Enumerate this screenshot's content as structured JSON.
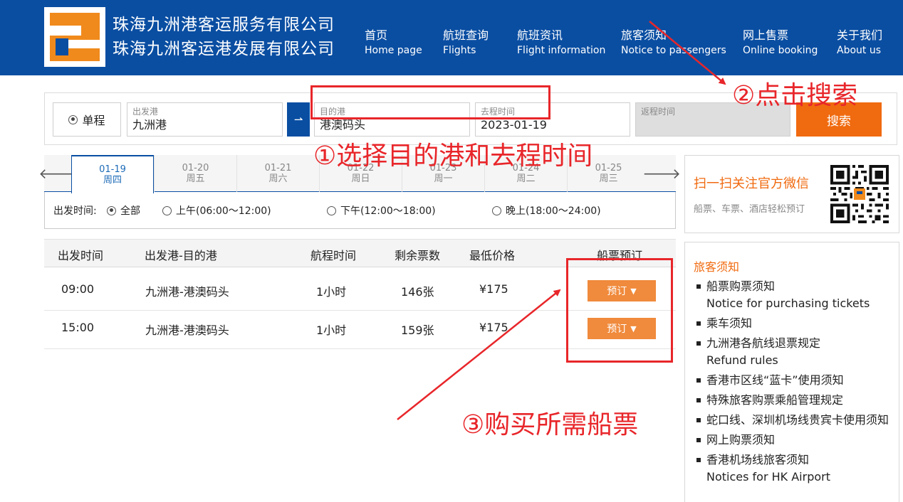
{
  "header": {
    "company_line1": "珠海九洲港客运服务有限公司",
    "company_line2": "珠海九洲客运港发展有限公司",
    "nav": [
      {
        "cn": "首页",
        "en": "Home page"
      },
      {
        "cn": "航班查询",
        "en": "Flights"
      },
      {
        "cn": "航班资讯",
        "en": "Flight information"
      },
      {
        "cn": "旅客须知",
        "en": "Notice to passengers"
      },
      {
        "cn": "网上售票",
        "en": "Online booking"
      },
      {
        "cn": "关于我们",
        "en": "About us"
      }
    ]
  },
  "search": {
    "trip_type": "单程",
    "from_label": "出发港",
    "from_value": "九洲港",
    "to_label": "目的港",
    "to_value": "港澳码头",
    "depart_label": "去程时间",
    "depart_value": "2023-01-19",
    "return_label": "返程时间",
    "search_button": "搜索",
    "swap_icon": "swap-arrow-icon"
  },
  "dates": [
    {
      "date": "01-19",
      "weekday": "周四",
      "selected": true
    },
    {
      "date": "01-20",
      "weekday": "周五"
    },
    {
      "date": "01-21",
      "weekday": "周六"
    },
    {
      "date": "01-22",
      "weekday": "周日"
    },
    {
      "date": "01-23",
      "weekday": "周一"
    },
    {
      "date": "01-24",
      "weekday": "周二"
    },
    {
      "date": "01-25",
      "weekday": "周三"
    }
  ],
  "filter": {
    "label": "出发时间:",
    "options": [
      "全部",
      "上午(06:00～12:00)",
      "下午(12:00～18:00)",
      "晚上(18:00～24:00)"
    ],
    "selected": "全部"
  },
  "results": {
    "headers": [
      "出发时间",
      "出发港-目的港",
      "航程时间",
      "剩余票数",
      "最低价格",
      "船票预订"
    ],
    "rows": [
      {
        "time": "09:00",
        "route": "九洲港-港澳码头",
        "duration": "1小时",
        "tickets": "146张",
        "price": "¥175",
        "book": "预订"
      },
      {
        "time": "15:00",
        "route": "九洲港-港澳码头",
        "duration": "1小时",
        "tickets": "159张",
        "price": "¥175",
        "book": "预订"
      }
    ]
  },
  "sidebar": {
    "wechat_title": "扫一扫关注官方微信",
    "wechat_sub": "船票、车票、酒店轻松预订",
    "notice_title": "旅客须知",
    "notices": [
      {
        "cn": "船票购票须知",
        "en": "Notice for purchasing tickets"
      },
      {
        "cn": "乘车须知",
        "en": ""
      },
      {
        "cn": "九洲港各航线退票规定",
        "en": "Refund rules"
      },
      {
        "cn": "香港市区线“蓝卡”使用须知",
        "en": ""
      },
      {
        "cn": "特殊旅客购票乘船管理规定",
        "en": ""
      },
      {
        "cn": "蛇口线、深圳机场线贵宾卡使用须知",
        "en": ""
      },
      {
        "cn": "网上购票须知",
        "en": ""
      },
      {
        "cn": "香港机场线旅客须知",
        "en": "Notices for HK Airport"
      }
    ]
  },
  "annotations": {
    "step1": "①选择目的港和去程时间",
    "step2": "②点击搜索",
    "step3": "③购买所需船票",
    "color": "#e8262a"
  },
  "colors": {
    "brand_blue": "#0a4ea2",
    "accent_orange": "#f06a0f",
    "button_orange": "#f08a3c"
  }
}
